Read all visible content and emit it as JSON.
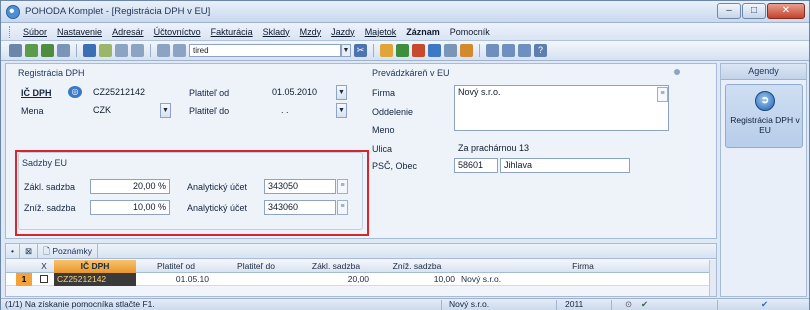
{
  "window": {
    "title": "POHODA Komplet - [Registrácia DPH v EU]",
    "buttons": {
      "minimize": "–",
      "maximize": "□",
      "close": "✕"
    }
  },
  "menu": [
    "Súbor",
    "Nastavenie",
    "Adresár",
    "Účtovníctvo",
    "Fakturácia",
    "Sklady",
    "Mzdy",
    "Jazdy",
    "Majetok",
    "Záznam",
    "Pomocník"
  ],
  "toolbar": {
    "search_value": "tired"
  },
  "form": {
    "registracia": {
      "title": "Registrácia DPH",
      "ic_dph_label": "IČ DPH",
      "ic_dph_value": "CZ25212142",
      "platitel_od_label": "Platiteľ od",
      "platitel_od_value": "01.05.2010",
      "mena_label": "Mena",
      "mena_value": "CZK",
      "platitel_do_label": "Platiteľ do",
      "platitel_do_value": ". ."
    },
    "sadzby": {
      "title": "Sadzby EU",
      "zakl_label": "Zákl. sadzba",
      "zakl_value": "20,00 %",
      "zakl_ucet_label": "Analytický účet",
      "zakl_ucet_value": "343050",
      "zniz_label": "Zníž. sadzba",
      "zniz_value": "10,00 %",
      "zniz_ucet_label": "Analytický účet",
      "zniz_ucet_value": "343060"
    },
    "prevadzkaren": {
      "title": "Prevádzkáreň v EU",
      "firma_label": "Firma",
      "firma_value": "Nový s.r.o.",
      "oddelenie_label": "Oddelenie",
      "meno_label": "Meno",
      "ulica_label": "Ulica",
      "ulica_value": "Za prachárnou 13",
      "psc_label": "PSČ, Obec",
      "psc_value": "58601",
      "obec_value": "Jihlava"
    }
  },
  "agenda": {
    "header": "Agendy",
    "tile_label": "Registrácia DPH v EU"
  },
  "grid": {
    "tab_label": "Poznámky",
    "columns": [
      "X",
      "IČ DPH",
      "Platiteľ od",
      "Platiteľ do",
      "Zákl. sadzba",
      "Zníž. sadzba",
      "Firma"
    ],
    "rows": [
      {
        "num": "1",
        "ic_dph": "CZ25212142",
        "platitel_od": "01.05.10",
        "platitel_do": "",
        "zakl": "20,00",
        "zniz": "10,00",
        "firma": "Nový s.r.o."
      }
    ]
  },
  "status": {
    "hint": "(1/1) Na získanie pomocníka stlačte F1.",
    "company": "Nový s.r.o.",
    "year": "2011"
  }
}
